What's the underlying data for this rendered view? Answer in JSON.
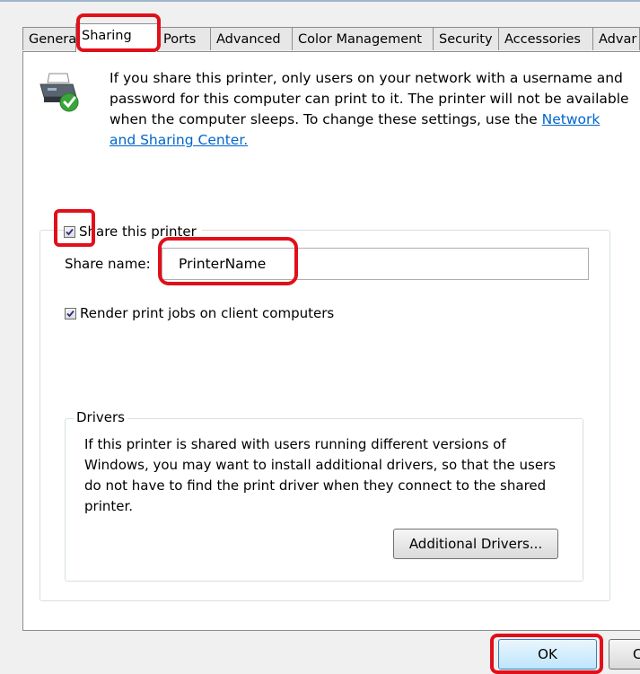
{
  "tabs": [
    {
      "label": "Genera"
    },
    {
      "label": "Sharing"
    },
    {
      "label": "Ports"
    },
    {
      "label": "Advanced"
    },
    {
      "label": "Color Management"
    },
    {
      "label": "Security"
    },
    {
      "label": "Accessories"
    },
    {
      "label": "Advar"
    }
  ],
  "intro": {
    "text": "If you share this printer, only users on your network with a username and password for this computer can print to it. The printer will not be available when the computer sleeps. To change these settings, use the ",
    "link": "Network and Sharing Center."
  },
  "share": {
    "checkbox_label": "Share this printer",
    "checked": true,
    "name_label": "Share name:",
    "name_value": "PrinterName"
  },
  "render": {
    "label": "Render print jobs on client computers",
    "checked": true
  },
  "drivers": {
    "title": "Drivers",
    "text": "If this printer is shared with users running different versions of Windows, you may want to install additional drivers, so that the users do not have to find the print driver when they connect to the shared printer.",
    "button": "Additional Drivers..."
  },
  "buttons": {
    "ok": "OK",
    "cancel": "C"
  },
  "colors": {
    "highlight": "#e0101a",
    "link": "#0066cc"
  },
  "icons": {
    "printer": "shared-printer-icon",
    "check": "checkmark-icon"
  }
}
